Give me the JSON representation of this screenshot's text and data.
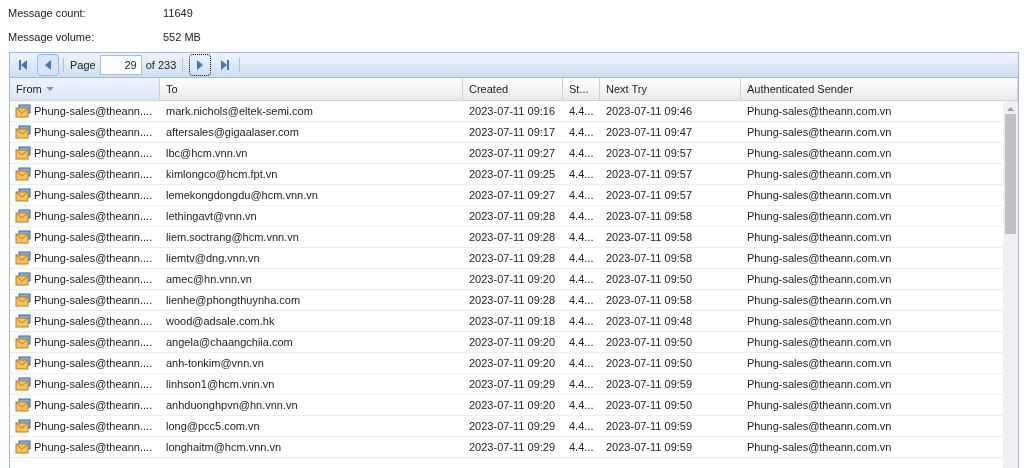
{
  "stats": [
    {
      "label": "Message count:",
      "value": "11649"
    },
    {
      "label": "Message volume:",
      "value": "552 MB"
    }
  ],
  "pager": {
    "label": "Page",
    "page": "29",
    "total": "of 233"
  },
  "columns": [
    {
      "label": "From",
      "sorted": true
    },
    {
      "label": "To",
      "sorted": false
    },
    {
      "label": "Created",
      "sorted": false
    },
    {
      "label": "St...",
      "sorted": false
    },
    {
      "label": "Next Try",
      "sorted": false
    },
    {
      "label": "Authenticated Sender",
      "sorted": false
    }
  ],
  "rows": [
    [
      "Phung-sales@theann....",
      "mark.nichols@eltek-semi.com",
      "2023-07-11 09:16",
      "4.4...",
      "2023-07-11 09:46",
      "Phung-sales@theann.com.vn"
    ],
    [
      "Phung-sales@theann....",
      "aftersales@gigaalaser.com",
      "2023-07-11 09:17",
      "4.4...",
      "2023-07-11 09:47",
      "Phung-sales@theann.com.vn"
    ],
    [
      "Phung-sales@theann....",
      "lbc@hcm.vnn.vn",
      "2023-07-11 09:27",
      "4.4...",
      "2023-07-11 09:57",
      "Phung-sales@theann.com.vn"
    ],
    [
      "Phung-sales@theann....",
      "kimlongco@hcm.fpt.vn",
      "2023-07-11 09:25",
      "4.4...",
      "2023-07-11 09:57",
      "Phung-sales@theann.com.vn"
    ],
    [
      "Phung-sales@theann....",
      "lemekongdongdu@hcm.vnn.vn",
      "2023-07-11 09:27",
      "4.4...",
      "2023-07-11 09:57",
      "Phung-sales@theann.com.vn"
    ],
    [
      "Phung-sales@theann....",
      "lethingavt@vnn.vn",
      "2023-07-11 09:28",
      "4.4...",
      "2023-07-11 09:58",
      "Phung-sales@theann.com.vn"
    ],
    [
      "Phung-sales@theann....",
      "liem.soctrang@hcm.vnn.vn",
      "2023-07-11 09:28",
      "4.4...",
      "2023-07-11 09:58",
      "Phung-sales@theann.com.vn"
    ],
    [
      "Phung-sales@theann....",
      "liemtv@dng.vnn.vn",
      "2023-07-11 09:28",
      "4.4...",
      "2023-07-11 09:58",
      "Phung-sales@theann.com.vn"
    ],
    [
      "Phung-sales@theann....",
      "amec@hn.vnn.vn",
      "2023-07-11 09:20",
      "4.4...",
      "2023-07-11 09:50",
      "Phung-sales@theann.com.vn"
    ],
    [
      "Phung-sales@theann....",
      "lienhe@phongthuynha.com",
      "2023-07-11 09:28",
      "4.4...",
      "2023-07-11 09:58",
      "Phung-sales@theann.com.vn"
    ],
    [
      "Phung-sales@theann....",
      "wood@adsale.com.hk",
      "2023-07-11 09:18",
      "4.4...",
      "2023-07-11 09:48",
      "Phung-sales@theann.com.vn"
    ],
    [
      "Phung-sales@theann....",
      "angela@chaangchiia.com",
      "2023-07-11 09:20",
      "4.4...",
      "2023-07-11 09:50",
      "Phung-sales@theann.com.vn"
    ],
    [
      "Phung-sales@theann....",
      "anh-tonkim@vnn.vn",
      "2023-07-11 09:20",
      "4.4...",
      "2023-07-11 09:50",
      "Phung-sales@theann.com.vn"
    ],
    [
      "Phung-sales@theann....",
      "linhson1@hcm.vnn.vn",
      "2023-07-11 09:29",
      "4.4...",
      "2023-07-11 09:59",
      "Phung-sales@theann.com.vn"
    ],
    [
      "Phung-sales@theann....",
      "anhduonghpvn@hn.vnn.vn",
      "2023-07-11 09:20",
      "4.4...",
      "2023-07-11 09:50",
      "Phung-sales@theann.com.vn"
    ],
    [
      "Phung-sales@theann....",
      "long@pcc5.com.vn",
      "2023-07-11 09:29",
      "4.4...",
      "2023-07-11 09:59",
      "Phung-sales@theann.com.vn"
    ],
    [
      "Phung-sales@theann....",
      "longhaitm@hcm.vnn.vn",
      "2023-07-11 09:29",
      "4.4...",
      "2023-07-11 09:59",
      "Phung-sales@theann.com.vn"
    ]
  ]
}
